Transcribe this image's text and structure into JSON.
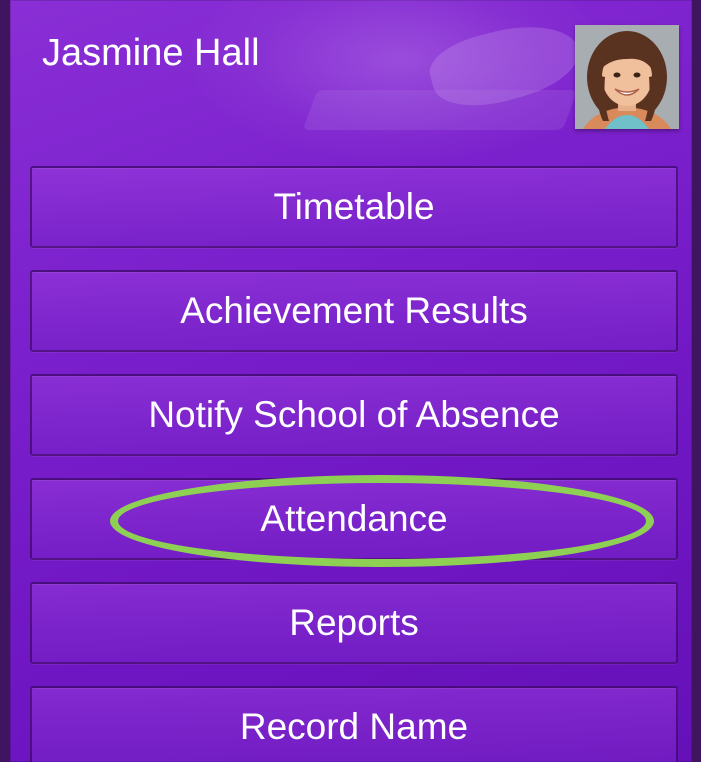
{
  "user": {
    "name": "Jasmine Hall"
  },
  "menu": {
    "items": [
      {
        "label": "Timetable"
      },
      {
        "label": "Achievement Results"
      },
      {
        "label": "Notify School of Absence"
      },
      {
        "label": "Attendance"
      },
      {
        "label": "Reports"
      },
      {
        "label": "Record Name"
      }
    ]
  },
  "highlight": {
    "target": "Attendance",
    "color": "#8ed053"
  },
  "colors": {
    "background": "#7a20cc",
    "frame": "#3f1560",
    "text": "#ffffff"
  }
}
